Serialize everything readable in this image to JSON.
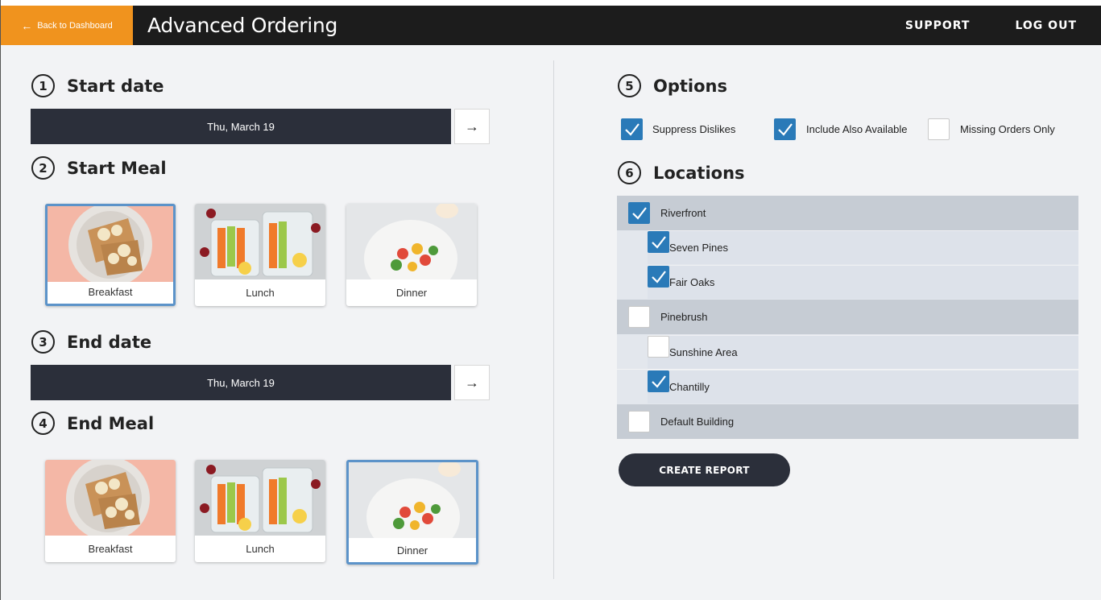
{
  "header": {
    "back_label": "Back to Dashboard",
    "title": "Advanced Ordering",
    "support_label": "SUPPORT",
    "logout_label": "LOG OUT"
  },
  "sections": {
    "s1": {
      "num": "1",
      "label": "Start date"
    },
    "s2": {
      "num": "2",
      "label": "Start Meal"
    },
    "s3": {
      "num": "3",
      "label": "End date"
    },
    "s4": {
      "num": "4",
      "label": "End Meal"
    },
    "s5": {
      "num": "5",
      "label": "Options"
    },
    "s6": {
      "num": "6",
      "label": "Locations"
    }
  },
  "start_date": "Thu, March 19",
  "end_date": "Thu, March 19",
  "meals": {
    "breakfast": "Breakfast",
    "lunch": "Lunch",
    "dinner": "Dinner"
  },
  "start_meal_selected": "Breakfast",
  "end_meal_selected": "Dinner",
  "options": [
    {
      "label": "Suppress Dislikes",
      "checked": true
    },
    {
      "label": "Include Also Available",
      "checked": true
    },
    {
      "label": "Missing Orders Only",
      "checked": false
    }
  ],
  "locations": [
    {
      "label": "Riverfront",
      "checked": true,
      "level": 0
    },
    {
      "label": "Seven Pines",
      "checked": true,
      "level": 1
    },
    {
      "label": "Fair Oaks",
      "checked": true,
      "level": 1
    },
    {
      "label": "Pinebrush",
      "checked": false,
      "level": 0
    },
    {
      "label": "Sunshine Area",
      "checked": false,
      "level": 1
    },
    {
      "label": "Chantilly",
      "checked": true,
      "level": 1
    },
    {
      "label": "Default Building",
      "checked": false,
      "level": 0
    }
  ],
  "create_report_label": "CREATE REPORT",
  "colors": {
    "accent_orange": "#f0931e",
    "dark": "#2b2f3a",
    "checkbox_blue": "#2a7ab8",
    "selected_border": "#5c93c9"
  }
}
